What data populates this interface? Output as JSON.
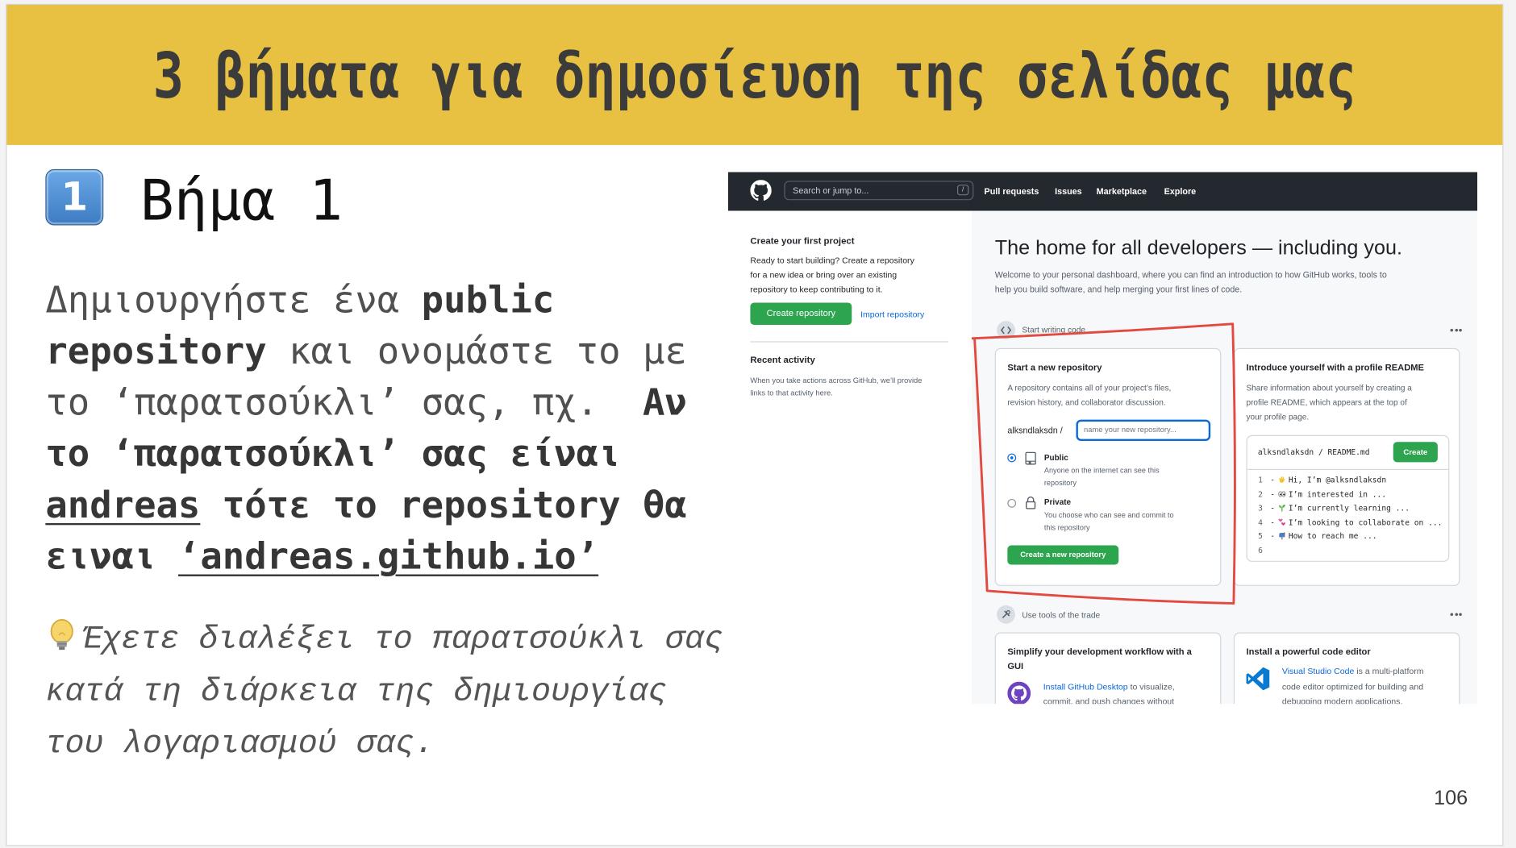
{
  "slide": {
    "title": "3 βήματα για δημοσίευση της σελίδας μας",
    "step_badge": "1",
    "step_label": "Βήμα 1",
    "instructions": [
      [
        "Δημιουργήστε ένα ",
        "public"
      ],
      [
        "repository",
        " και ονομάστε το με"
      ],
      [
        "το ‘παρατσούκλι’ σας, πχ.  ",
        "Αν"
      ],
      [
        "το ‘παρατσούκλι’ σας είναι"
      ],
      [
        "andreas",
        " τότε το repository θα"
      ],
      [
        "ειναι ",
        "‘andreas.github.io’"
      ]
    ],
    "tip_icon": "lightbulb-icon",
    "tip_lines": [
      "Έχετε διαλέξει το παρατσούκλι σας",
      "κατά τη διάρκεια της δημιουργίας",
      "του λογαριασμού σας."
    ],
    "page_number": "106"
  },
  "github_screenshot": {
    "header": {
      "logo_icon": "github-mark-icon",
      "search_placeholder": "Search or jump to...",
      "search_key": "/",
      "nav": [
        "Pull requests",
        "Issues",
        "Marketplace",
        "Explore"
      ]
    },
    "sidebar": {
      "first_project_title": "Create your first project",
      "first_project_text": [
        "Ready to start building? Create a repository",
        "for a new idea or bring over an existing",
        "repository to keep contributing to it."
      ],
      "create_button": "Create repository",
      "import_link": "Import repository",
      "recent_activity_title": "Recent activity",
      "recent_activity_text": [
        "When you take actions across GitHub, we’ll provide",
        "links to that activity here."
      ]
    },
    "main": {
      "heading": "The home for all developers — including you.",
      "intro": [
        "Welcome to your personal dashboard, where you can find an introduction to how GitHub works, tools to",
        "help you build software, and help merging your first lines of code."
      ],
      "section1_label": "Start writing code",
      "new_repo": {
        "title": "Start a new repository",
        "text": [
          "A repository contains all of your project’s files,",
          "revision history, and collaborator discussion."
        ],
        "owner": "alksndlaksdn /",
        "name_placeholder": "name your new repository...",
        "visibility_selected": "Public",
        "public_label": "Public",
        "public_desc": [
          "Anyone on the internet can see this",
          "repository"
        ],
        "private_label": "Private",
        "private_desc": [
          "You choose who can see and commit to",
          "this repository"
        ],
        "create_button": "Create a new repository"
      },
      "readme": {
        "title": "Introduce yourself with a profile README",
        "text": [
          "Share information about yourself by creating a",
          "profile README, which appears at the top of",
          "your profile page."
        ],
        "file_path": "alksndlaksdn / README.md",
        "create_button": "Create",
        "code_lines": [
          {
            "num": "1",
            "prefix": "-",
            "icon": "waving-hand",
            "text": "Hi, I’m @alksndlaksdn"
          },
          {
            "num": "2",
            "prefix": "-",
            "icon": "eyes",
            "text": "I’m interested in ..."
          },
          {
            "num": "3",
            "prefix": "-",
            "icon": "seedling",
            "text": "I’m currently learning ..."
          },
          {
            "num": "4",
            "prefix": "-",
            "icon": "revolving-hearts",
            "text": "I’m looking to collaborate on ..."
          },
          {
            "num": "5",
            "prefix": "-",
            "icon": "mailbox",
            "text": "How to reach me ..."
          },
          {
            "num": "6",
            "prefix": "",
            "icon": "",
            "text": ""
          }
        ]
      },
      "section2_label": "Use tools of the trade",
      "desktop": {
        "title": [
          "Simplify your development workflow with a",
          "GUI"
        ],
        "link": "Install GitHub Desktop",
        "text_after_link": " to visualize,",
        "text": [
          "commit, and push changes without"
        ]
      },
      "editor": {
        "title": "Install a powerful code editor",
        "link": "Visual Studio Code",
        "text_after_link": " is a multi-platform",
        "text": [
          "code editor optimized for building and",
          "debugging modern applications."
        ]
      }
    }
  },
  "colors": {
    "header_yellow": "#E8C143",
    "badge_blue": "#4a8fd6",
    "github_header": "#24292f",
    "primary_green": "#2da44e",
    "link_blue": "#0969da",
    "annotation_red": "#e34a3f"
  }
}
